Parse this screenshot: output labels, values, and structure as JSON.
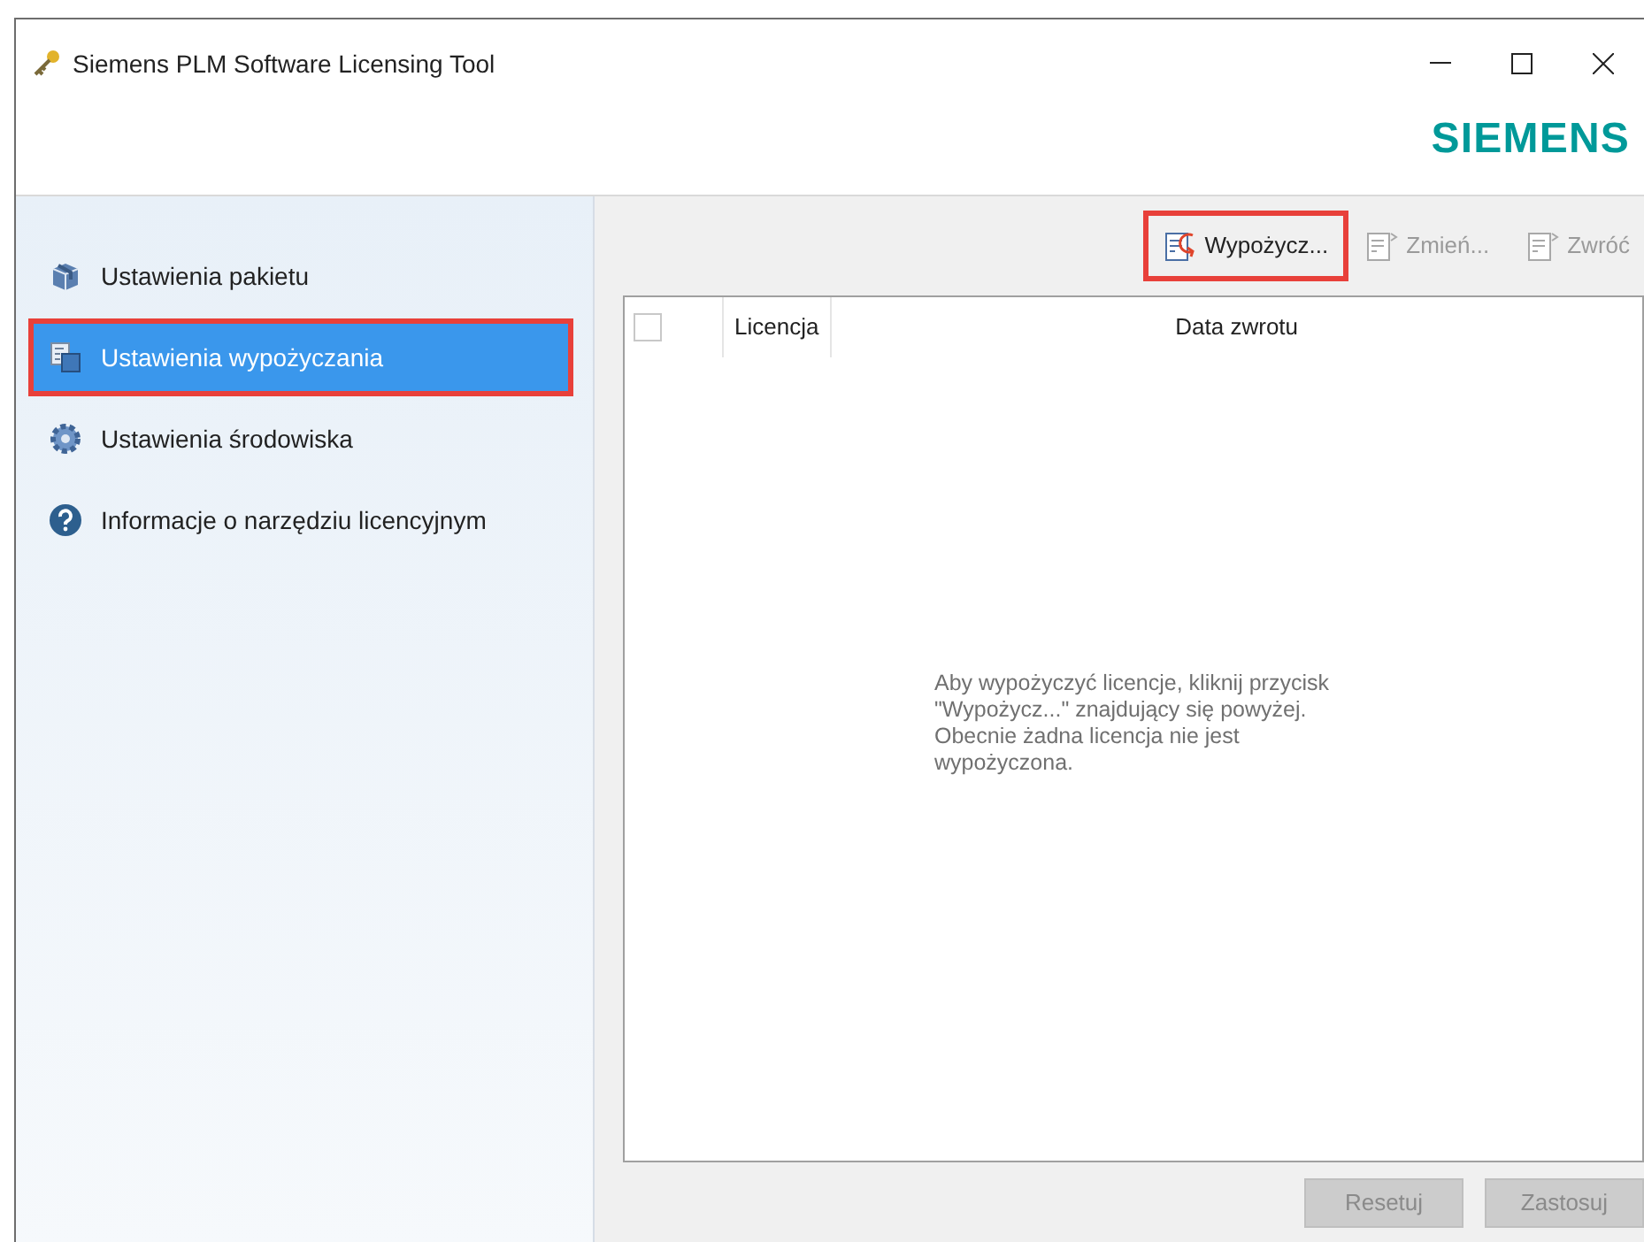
{
  "window": {
    "title": "Siemens PLM Software Licensing Tool",
    "logo": "SIEMENS"
  },
  "sidebar": {
    "items": [
      {
        "label": "Ustawienia pakietu",
        "kind": "package",
        "selected": false,
        "highlighted": false
      },
      {
        "label": "Ustawienia wypożyczania",
        "kind": "borrow",
        "selected": true,
        "highlighted": true
      },
      {
        "label": "Ustawienia środowiska",
        "kind": "gear",
        "selected": false,
        "highlighted": false
      },
      {
        "label": "Informacje o narzędziu licencyjnym",
        "kind": "help",
        "selected": false,
        "highlighted": false
      }
    ]
  },
  "toolbar": [
    {
      "label": "Wypożycz...",
      "disabled": false,
      "highlighted": true
    },
    {
      "label": "Zmień...",
      "disabled": true,
      "highlighted": false
    },
    {
      "label": "Zwróć",
      "disabled": true,
      "highlighted": false
    }
  ],
  "table": {
    "select_all": {
      "checked": false
    },
    "columns": [
      "Licencja",
      "Data zwrotu"
    ],
    "empty_message": "Aby wypożyczyć licencje, kliknij przycisk \"Wypożycz...\" znajdujący się powyżej. Obecnie żadna licencja nie jest wypożyczona."
  },
  "buttons": [
    {
      "label": "Resetuj",
      "disabled": true
    },
    {
      "label": "Zastosuj",
      "disabled": true
    }
  ]
}
